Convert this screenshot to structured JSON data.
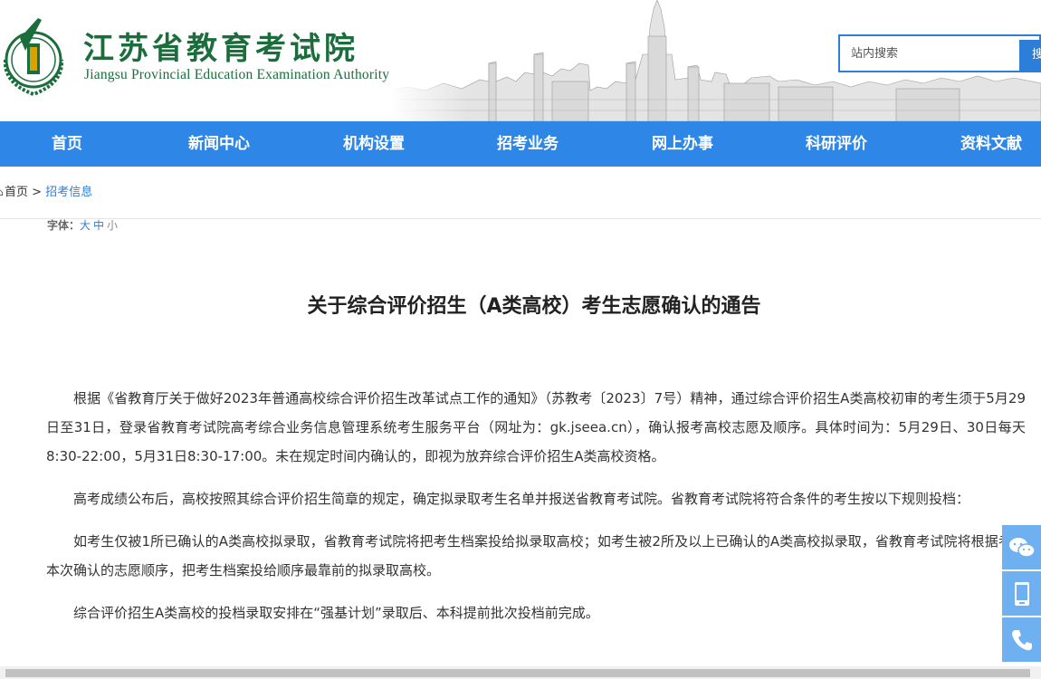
{
  "header": {
    "site_title": "江苏省教育考试院",
    "site_subtitle": "Jiangsu Provincial Education Examination Authority",
    "logo_icon": "education-emblem-icon",
    "search": {
      "placeholder": "站内搜索",
      "button_label": "搜"
    }
  },
  "nav": {
    "items": [
      {
        "label": "首页"
      },
      {
        "label": "新闻中心"
      },
      {
        "label": "机构设置"
      },
      {
        "label": "招考业务"
      },
      {
        "label": "网上办事"
      },
      {
        "label": "科研评价"
      },
      {
        "label": "资料文献"
      }
    ],
    "color": "#2e86e6"
  },
  "breadcrumb": {
    "home": "首页",
    "separator": ">",
    "current": "招考信息"
  },
  "font_size": {
    "label": "字体：",
    "options": [
      "大",
      "中",
      "小"
    ]
  },
  "article": {
    "title": "关于综合评价招生（A类高校）考生志愿确认的通告",
    "paragraphs": [
      "根据《省教育厅关于做好2023年普通高校综合评价招生改革试点工作的通知》（苏教考〔2023〕7号）精神，通过综合评价招生A类高校初审的考生须于5月29日至31日，登录省教育考试院高考综合业务信息管理系统考生服务平台（网址为：gk.jseea.cn），确认报考高校志愿及顺序。具体时间为：5月29日、30日每天8:30-22:00，5月31日8:30-17:00。未在规定时间内确认的，即视为放弃综合评价招生A类高校资格。",
      "高考成绩公布后，高校按照其综合评价招生简章的规定，确定拟录取考生名单并报送省教育考试院。省教育考试院将符合条件的考生按以下规则投档：",
      "如考生仅被1所已确认的A类高校拟录取，省教育考试院将把考生档案投给拟录取高校；如考生被2所及以上已确认的A类高校拟录取，省教育考试院将根据考生本次确认的志愿顺序，把考生档案投给顺序最靠前的拟录取高校。",
      "综合评价招生A类高校的投档录取安排在“强基计划”录取后、本科提前批次投档前完成。"
    ]
  },
  "side_bar": {
    "icons": [
      "wechat-icon",
      "mobile-icon",
      "phone-icon"
    ],
    "color": "#6fb1f0"
  }
}
